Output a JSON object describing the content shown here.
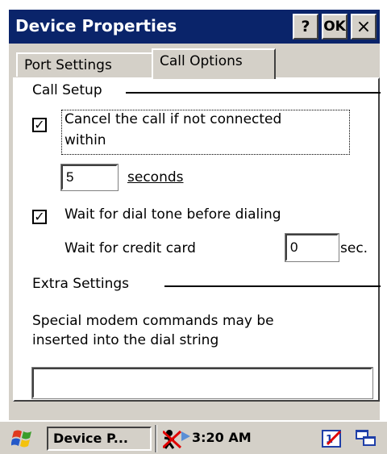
{
  "window": {
    "title": "Device Properties",
    "help_label": "?",
    "ok_label": "OK",
    "close_label": "×"
  },
  "tabs": [
    {
      "label": "Port Settings",
      "active": false
    },
    {
      "label": "Call Options",
      "active": true
    }
  ],
  "call_setup": {
    "heading": "Call Setup",
    "cancel_checkbox": {
      "checked": true,
      "label_line1": "Cancel the call if not connected",
      "label_line2": "within"
    },
    "seconds_value": "5",
    "seconds_label": "seconds",
    "dial_tone_checkbox": {
      "checked": true,
      "label": "Wait for dial tone before dialing"
    },
    "credit_card_label": "Wait for credit card",
    "credit_card_value": "0",
    "sec_label": "sec."
  },
  "extra_settings": {
    "heading": "Extra Settings",
    "description_line1": "Special modem commands may be",
    "description_line2": "inserted into the dial string",
    "commands_value": ""
  },
  "taskbar": {
    "start_icon": "windows-flag-icon",
    "task_button_label": "Device P...",
    "clock": "3:20 AM",
    "tray_icons": [
      "network-disconnected-icon",
      "connection-arrow-icon",
      "input-panel-icon",
      "desktop-icon"
    ]
  },
  "colors": {
    "titlebar": "#0a246a",
    "face": "#d4d0c8"
  }
}
